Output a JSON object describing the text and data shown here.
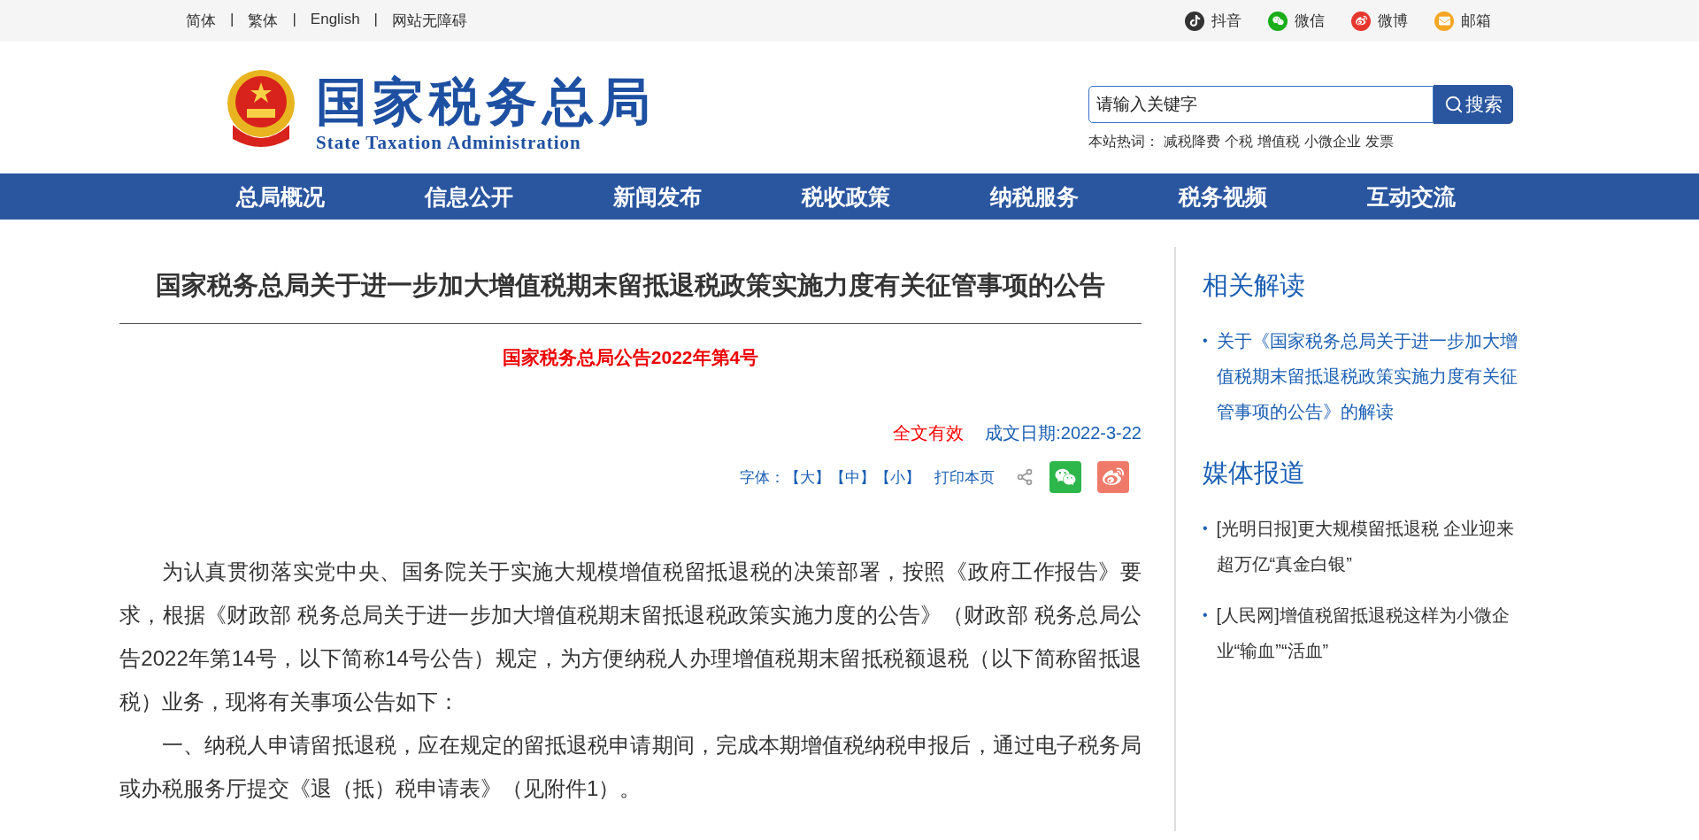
{
  "top_bar": {
    "links": [
      "简体",
      "繁体",
      "English",
      "网站无障碍"
    ],
    "separator": "|",
    "social": [
      {
        "label": "抖音",
        "kind": "douyin"
      },
      {
        "label": "微信",
        "kind": "wechat"
      },
      {
        "label": "微博",
        "kind": "weibo"
      },
      {
        "label": "邮箱",
        "kind": "mail"
      }
    ]
  },
  "header": {
    "title": "国家税务总局",
    "subtitle": "State Taxation Administration",
    "search": {
      "placeholder": "请输入关键字",
      "button": "搜索"
    },
    "hot_label": "本站热词：",
    "hot_words": [
      "减税降费",
      "个税",
      "增值税",
      "小微企业",
      "发票"
    ]
  },
  "nav": [
    "总局概况",
    "信息公开",
    "新闻发布",
    "税收政策",
    "纳税服务",
    "税务视频",
    "互动交流"
  ],
  "article": {
    "title": "国家税务总局关于进一步加大增值税期末留抵退税政策实施力度有关征管事项的公告",
    "doc_number": "国家税务总局公告2022年第4号",
    "validity": "全文有效",
    "date": "成文日期:2022-3-22",
    "font_label": "字体：",
    "font_sizes": [
      "【大】",
      "【中】",
      "【小】"
    ],
    "print": "打印本页",
    "paragraphs": [
      "为认真贯彻落实党中央、国务院关于实施大规模增值税留抵退税的决策部署，按照《政府工作报告》要求，根据《财政部 税务总局关于进一步加大增值税期末留抵退税政策实施力度的公告》（财政部 税务总局公告2022年第14号，以下简称14号公告）规定，为方便纳税人办理增值税期末留抵税额退税（以下简称留抵退税）业务，现将有关事项公告如下：",
      "一、纳税人申请留抵退税，应在规定的留抵退税申请期间，完成本期增值税纳税申报后，通过电子税务局或办税服务厅提交《退（抵）税申请表》（见附件1）。"
    ]
  },
  "bullet": "•",
  "sidebar": [
    {
      "heading": "相关解读",
      "items": [
        "关于《国家税务总局关于进一步加大增值税期末留抵退税政策实施力度有关征管事项的公告》的解读"
      ]
    },
    {
      "heading": "媒体报道",
      "items": [
        "[光明日报]更大规模留抵退税 企业迎来超万亿“真金白银”",
        "[人民网]增值税留抵退税这样为小微企业“输血”“活血”"
      ]
    }
  ]
}
